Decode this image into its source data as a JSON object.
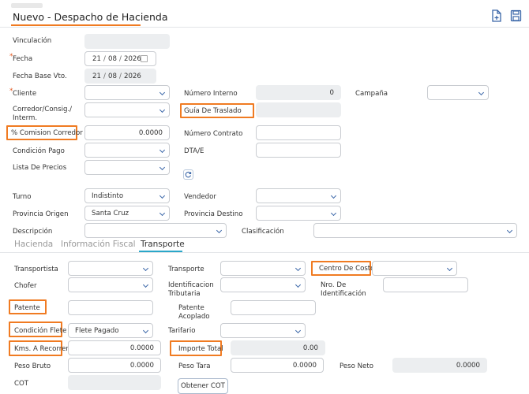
{
  "header": {
    "breadcrumb": "",
    "title": "Nuevo - Despacho de Hacienda"
  },
  "form": {
    "vinculacion_label": "Vinculación",
    "fecha_label": "Fecha",
    "fecha_day": "21",
    "fecha_month": "08",
    "fecha_year": "2026",
    "fecha_base_label": "Fecha Base Vto.",
    "fecha_base_day": "21",
    "fecha_base_month": "08",
    "fecha_base_year": "2026",
    "cliente_label": "Cliente",
    "numero_interno_label": "Número Interno",
    "numero_interno_value": "0",
    "campana_label": "Campaña",
    "corredor_label": "Corredor/Consig./ Interm.",
    "guia_label": "Guía De Traslado",
    "comision_label": "% Comision Corredor",
    "comision_value": "0.0000",
    "numero_contrato_label": "Número Contrato",
    "condicion_pago_label": "Condición Pago",
    "dtae_label": "DTA/E",
    "lista_precios_label": "Lista De Precios",
    "turno_label": "Turno",
    "turno_value": "Indistinto",
    "vendedor_label": "Vendedor",
    "provincia_origen_label": "Provincia Origen",
    "provincia_origen_value": "Santa Cruz",
    "provincia_destino_label": "Provincia Destino",
    "descripcion_label": "Descripción",
    "clasificacion_label": "Clasificación"
  },
  "tabs": [
    {
      "label": "Hacienda"
    },
    {
      "label": "Información Fiscal"
    },
    {
      "label": "Transporte"
    }
  ],
  "transporte": {
    "transportista_label": "Transportista",
    "transporte_label": "Transporte",
    "centro_costo_label": "Centro De Costo",
    "chofer_label": "Chofer",
    "identificacion_label": "Identificacion Tributaria",
    "nro_identificacion_label": "Nro. De Identificación",
    "patente_label": "Patente",
    "patente_acoplado_label": "Patente Acoplado",
    "condicion_flete_label": "Condición Flete",
    "condicion_flete_value": "Flete Pagado",
    "tarifario_label": "Tarifario",
    "kms_label": "Kms. A Recorrer",
    "kms_value": "0.0000",
    "importe_total_label": "Importe Total",
    "importe_total_value": "0.00",
    "peso_bruto_label": "Peso Bruto",
    "peso_bruto_value": "0.0000",
    "peso_tara_label": "Peso Tara",
    "peso_tara_value": "0.0000",
    "peso_neto_label": "Peso Neto",
    "peso_neto_value": "0.0000",
    "cot_label": "COT",
    "obtener_cot_label": "Obtener COT"
  },
  "colors": {
    "highlight": "#f07b22",
    "accent": "#3a66a8",
    "tab_underline": "#2aa7c9"
  }
}
